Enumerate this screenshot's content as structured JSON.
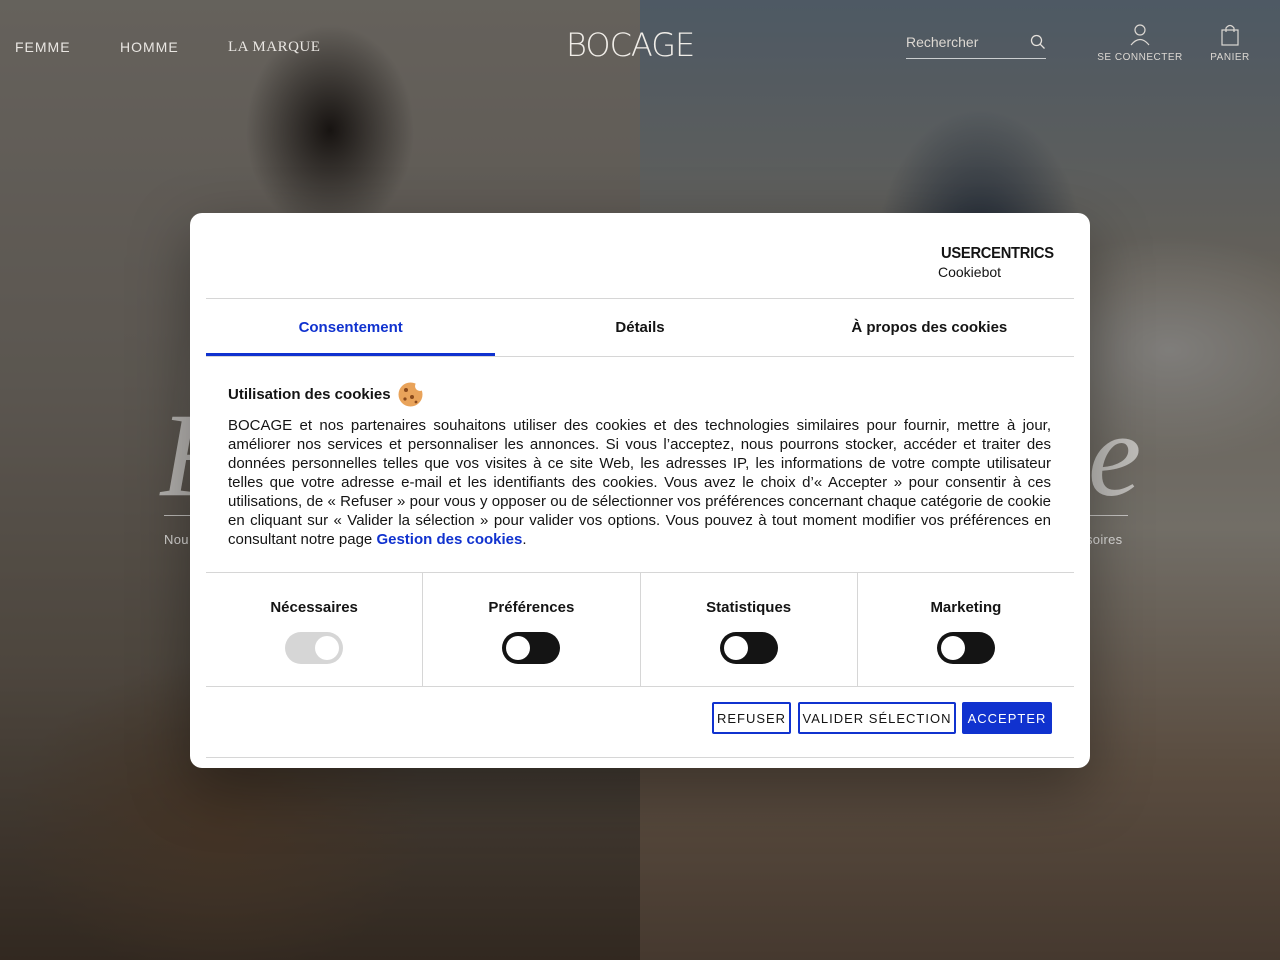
{
  "header": {
    "nav": [
      "FEMME",
      "HOMME",
      "LA MARQUE"
    ],
    "logo": "BOCAGE",
    "search_placeholder": "Rechercher",
    "login_label": "SE CONNECTER",
    "cart_label": "PANIER"
  },
  "hero": {
    "left_caption": "Nou",
    "right_caption": "soires"
  },
  "dialog": {
    "provider_name": "USERCENTRICS",
    "provider_product": "Cookiebot",
    "tabs": [
      {
        "label": "Consentement",
        "active": true
      },
      {
        "label": "Détails",
        "active": false
      },
      {
        "label": "À propos des cookies",
        "active": false
      }
    ],
    "title": "Utilisation des cookies",
    "body": "BOCAGE et nos partenaires souhaitons utiliser des cookies et des technologies similaires pour fournir, mettre à jour, améliorer nos services et personnaliser les annonces. Si vous l’acceptez, nous pourrons stocker, accéder et traiter des données personnelles telles que vos visites à ce site Web, les adresses IP, les informations de votre compte utilisateur telles que votre adresse e-mail et les identifiants des cookies. Vous avez le choix d’« Accepter » pour consentir à ces utilisations, de « Refuser » pour vous y opposer ou de sélectionner vos préférences concernant chaque catégorie de cookie en cliquant sur « Valider la sélection » pour valider vos options. Vous pouvez à tout moment modifier vos préférences en consultant notre page",
    "link_text": "Gestion des cookies",
    "body_end": ".",
    "categories": [
      {
        "label": "Nécessaires",
        "enabled": true,
        "locked": true
      },
      {
        "label": "Préférences",
        "enabled": false,
        "locked": false
      },
      {
        "label": "Statistiques",
        "enabled": false,
        "locked": false
      },
      {
        "label": "Marketing",
        "enabled": false,
        "locked": false
      }
    ],
    "buttons": {
      "refuse": "REFUSER",
      "validate": "VALIDER SÉLECTION",
      "accept": "ACCEPTER"
    }
  },
  "colors": {
    "accent": "#1032cf",
    "toggle_off": "#141414",
    "toggle_locked": "#d6d6d6"
  }
}
